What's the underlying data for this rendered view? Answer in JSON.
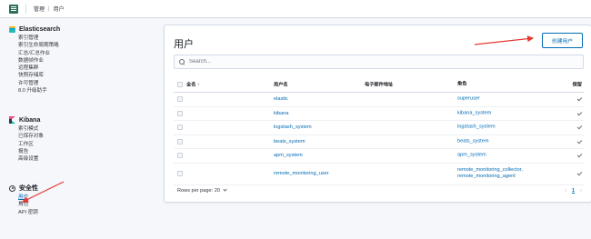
{
  "topbar": {
    "breadcrumb": [
      "管理",
      "用户"
    ]
  },
  "sidebar": {
    "elasticsearch": {
      "title": "Elasticsearch",
      "items": [
        "索引管理",
        "索引生命周期策略",
        "汇总/汇总作业",
        "数据帧作业",
        "远程集群",
        "快照存储库",
        "许可管理",
        "8.0 升级助手"
      ]
    },
    "kibana": {
      "title": "Kibana",
      "items": [
        "索引模式",
        "已保存对象",
        "工作区",
        "报告",
        "高级设置"
      ]
    },
    "security": {
      "title": "安全性",
      "items": [
        "用户",
        "角色",
        "API 密钥"
      ]
    }
  },
  "main": {
    "title": "用户",
    "create_button": "创建用户",
    "search_placeholder": "Search...",
    "columns": {
      "select_all": "全名 ↑",
      "username": "用户名",
      "email": "电子邮件地址",
      "roles": "角色",
      "reserved": "保留"
    },
    "rows": [
      {
        "username": "elastic",
        "email": "",
        "roles": [
          "superuser"
        ],
        "reserved": true
      },
      {
        "username": "kibana",
        "email": "",
        "roles": [
          "kibana_system"
        ],
        "reserved": true
      },
      {
        "username": "logstash_system",
        "email": "",
        "roles": [
          "logstash_system"
        ],
        "reserved": true
      },
      {
        "username": "beats_system",
        "email": "",
        "roles": [
          "beats_system"
        ],
        "reserved": true
      },
      {
        "username": "apm_system",
        "email": "",
        "roles": [
          "apm_system"
        ],
        "reserved": true
      },
      {
        "username": "remote_monitoring_user",
        "email": "",
        "roles": [
          "remote_monitoring_collector,",
          "remote_monitoring_agent"
        ],
        "reserved": true
      }
    ],
    "rows_per_page": "Rows per page: 20",
    "pagination": {
      "prev": "‹",
      "current": "1",
      "next": "›"
    }
  },
  "colors": {
    "accent": "#006bb4",
    "arrow": "#e53935"
  }
}
